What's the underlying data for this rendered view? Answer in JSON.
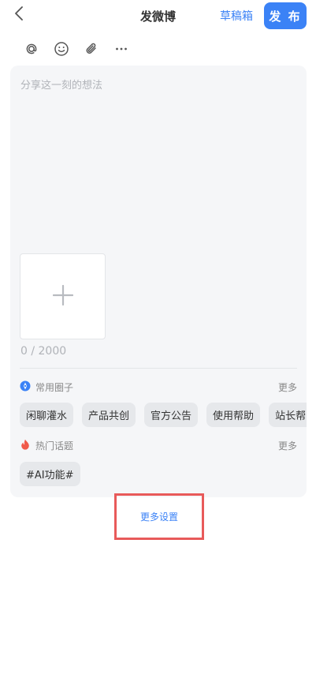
{
  "header": {
    "title": "发微博",
    "drafts_label": "草稿箱",
    "publish_label": "发 布"
  },
  "toolbar": {
    "icons": [
      "at-icon",
      "emoji-icon",
      "attachment-icon",
      "more-icon"
    ]
  },
  "editor": {
    "placeholder": "分享这一刻的想法",
    "counter": "0 / 2000"
  },
  "circles": {
    "title": "常用圈子",
    "more": "更多",
    "items": [
      "闲聊灌水",
      "产品共创",
      "官方公告",
      "使用帮助",
      "站长帮"
    ]
  },
  "topics": {
    "title": "热门话题",
    "more": "更多",
    "items": [
      "#AI功能#"
    ]
  },
  "footer": {
    "more_settings": "更多设置"
  },
  "colors": {
    "accent": "#3b82f6",
    "panel_bg": "#f5f6f8",
    "highlight_border": "#e85a5a"
  }
}
